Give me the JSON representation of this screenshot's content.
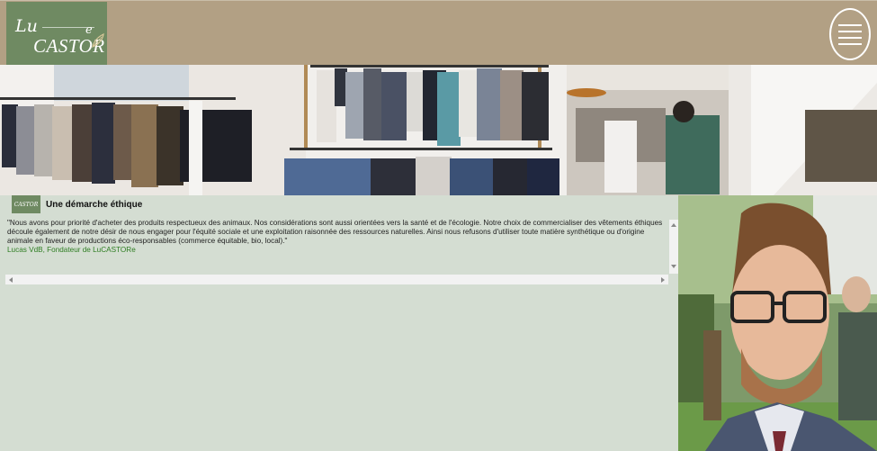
{
  "header": {
    "logo": {
      "lu": "Lu",
      "castor": "CASTOR",
      "e": "e"
    },
    "menu_icon": "hamburger-menu-icon"
  },
  "banner": {
    "image": "clothing-store-racks-photo"
  },
  "article": {
    "logo_text": "CASTOR",
    "title": "Une démarche éthique",
    "quote": "\"Nous avons pour priorité d'acheter des produits respectueux des animaux. Nos considérations sont aussi orientées vers la santé et de l'écologie. Notre choix de commercialiser des vêtements éthiques découle également de notre désir de nous engager pour l'équité sociale et une exploitation raisonnée des ressources naturelles. Ainsi nous refusons d'utiliser toute matière synthétique ou d'origine animale en faveur de productions éco-responsables (commerce équitable, bio, local).\"",
    "signature": "Lucas VdB, Fondateur de LuCASTORe"
  },
  "portrait": {
    "image": "founder-portrait-photo"
  },
  "colors": {
    "header_bg": "#b2a084",
    "logo_bg": "#6f8a62",
    "panel_bg": "#d4ddd2",
    "signature": "#2e7d22"
  }
}
